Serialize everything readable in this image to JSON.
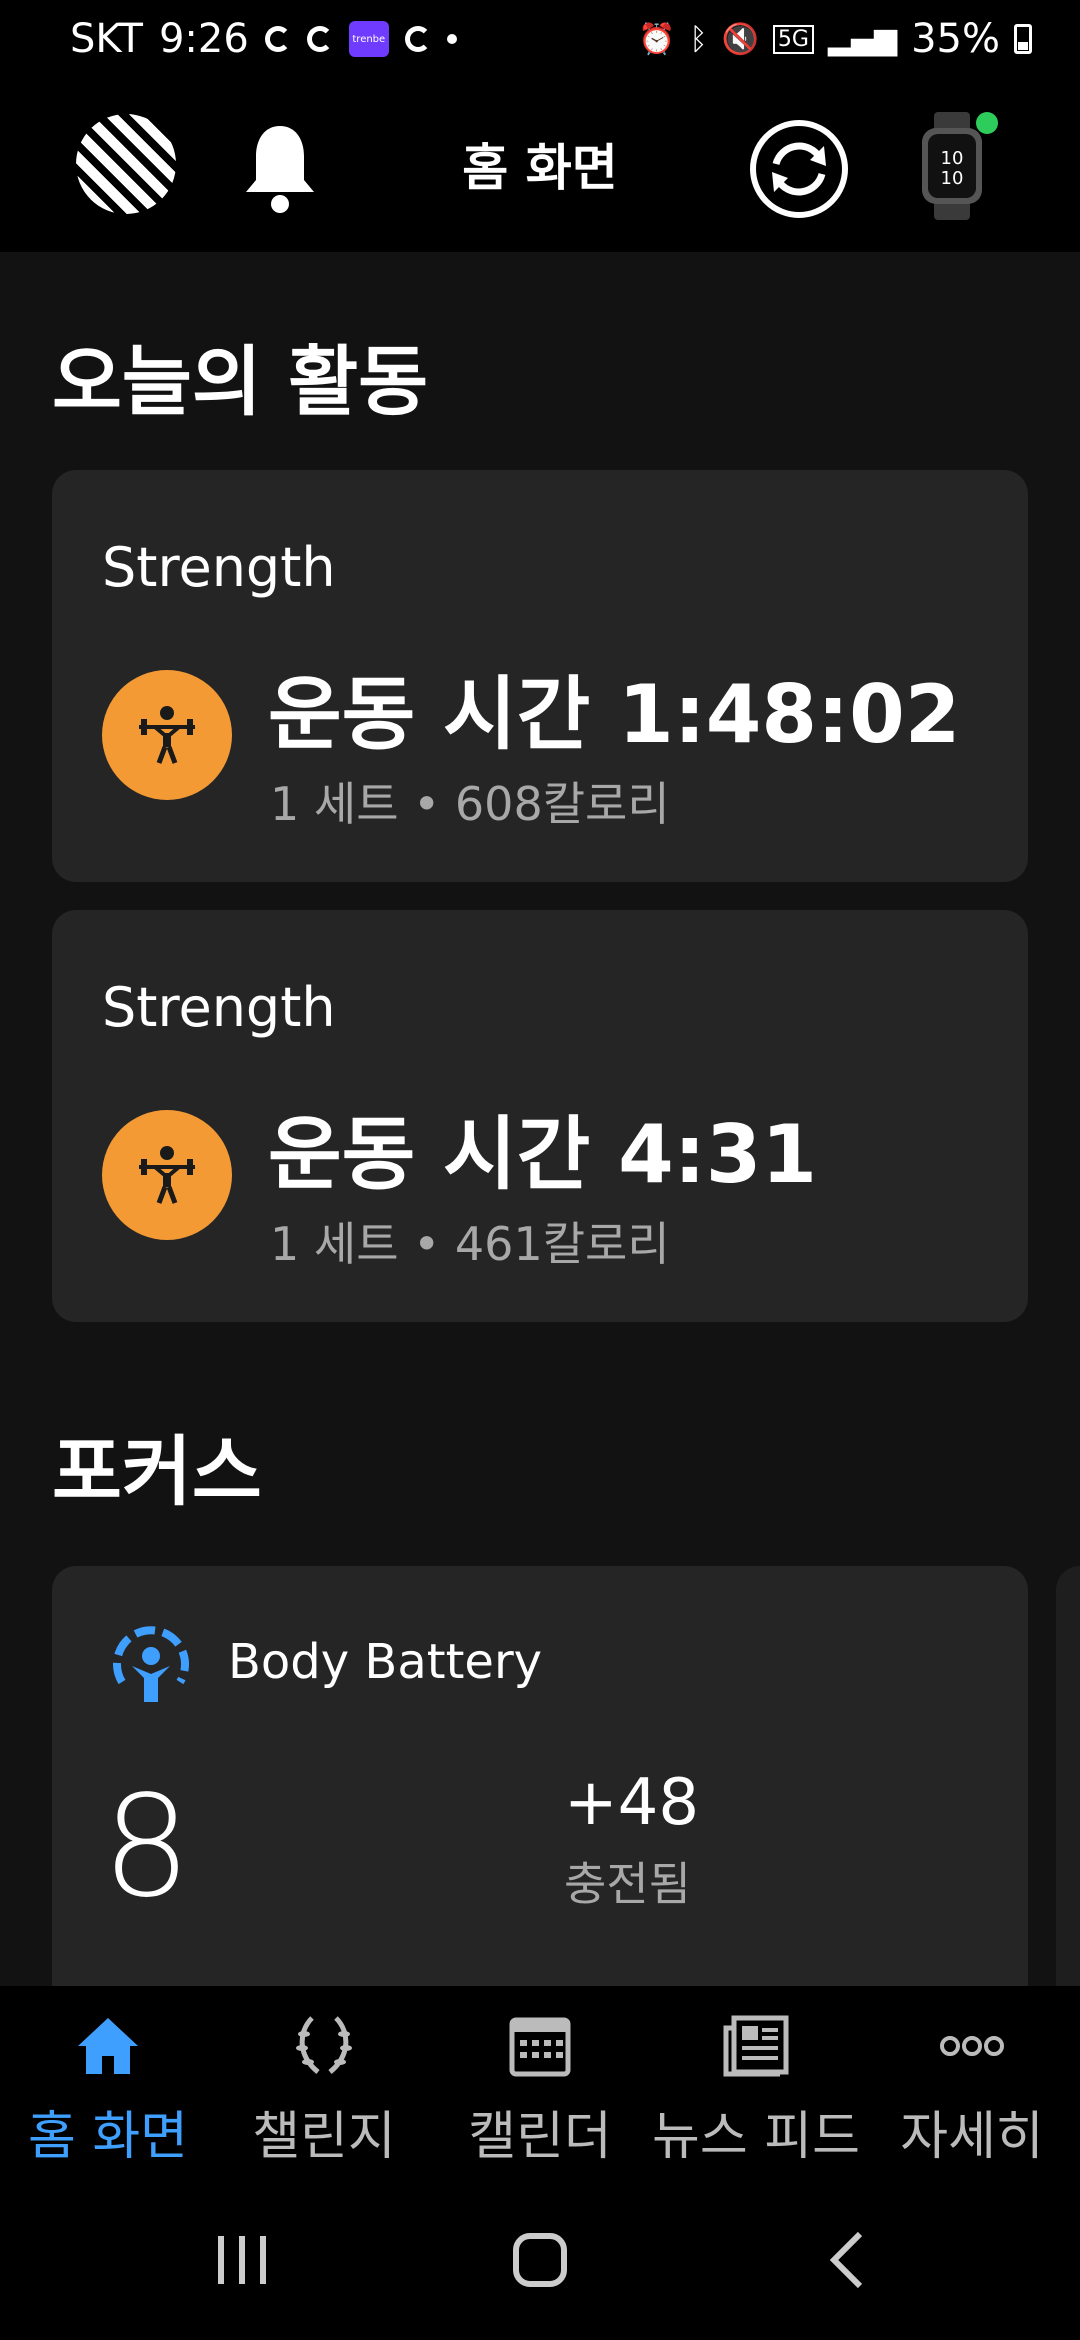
{
  "status_bar": {
    "carrier": "SKT",
    "time": "9:26",
    "app_badge": "trenbe",
    "network": "5G",
    "battery": "35%"
  },
  "header": {
    "title": "홈 화면"
  },
  "today": {
    "title": "오늘의 활동",
    "activities": [
      {
        "type": "Strength",
        "duration": "운동 시간 1:48:02",
        "meta": "1 세트 • 608칼로리",
        "icon": "weightlifting-icon"
      },
      {
        "type": "Strength",
        "duration": "운동 시간 4:31",
        "meta": "1 세트 • 461칼로리",
        "icon": "weightlifting-icon"
      }
    ]
  },
  "focus": {
    "title": "포커스",
    "body_battery": {
      "label": "Body Battery",
      "value": "8",
      "charged": "+48",
      "charged_label": "충전됨"
    }
  },
  "bottom_nav": {
    "items": [
      {
        "label": "홈 화면",
        "icon": "home-icon",
        "active": true
      },
      {
        "label": "챌린지",
        "icon": "laurel-icon"
      },
      {
        "label": "캘린더",
        "icon": "calendar-icon"
      },
      {
        "label": "뉴스 피드",
        "icon": "newsfeed-icon"
      },
      {
        "label": "자세히",
        "icon": "more-icon"
      }
    ]
  },
  "colors": {
    "accent": "#3f9fff",
    "activity_icon_bg": "#f39a35",
    "card_bg": "#252525",
    "online": "#2ecc5a"
  }
}
